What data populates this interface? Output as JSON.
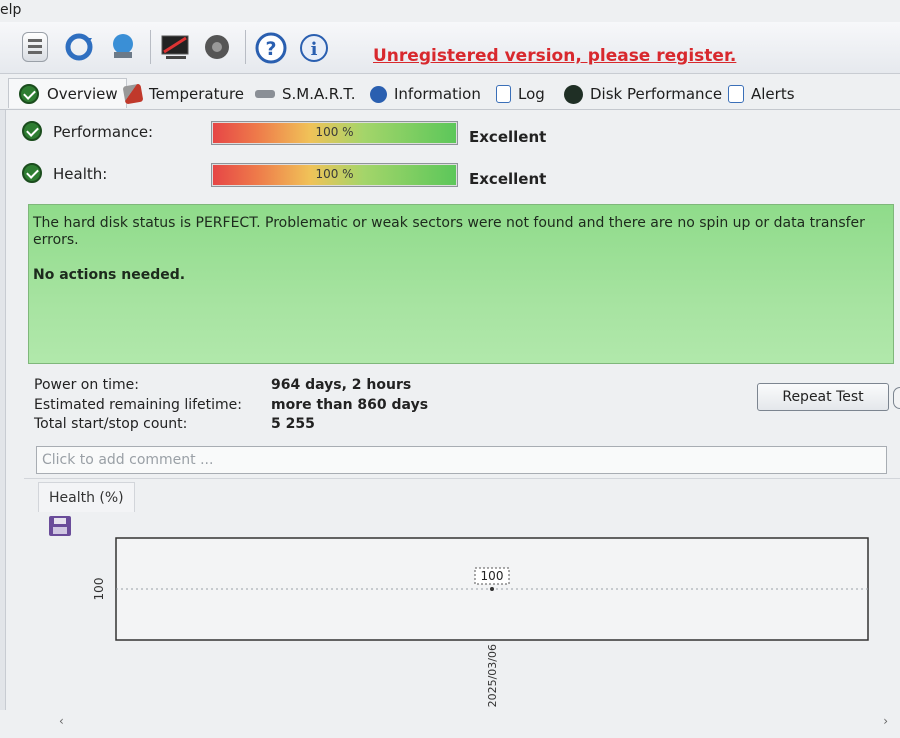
{
  "menu": {
    "help_partial": "elp"
  },
  "toolbar": {
    "icons": [
      "report-icon",
      "refresh-icon",
      "network-icon",
      "screenshot-icon",
      "speaker-icon",
      "help-icon",
      "info-icon"
    ],
    "unregistered_text": "Unregistered version, please register."
  },
  "tabs": [
    {
      "label": "Overview",
      "icon": "check-icon"
    },
    {
      "label": "Temperature",
      "icon": "thermometer-icon"
    },
    {
      "label": "S.M.A.R.T.",
      "icon": "smart-icon"
    },
    {
      "label": "Information",
      "icon": "info-icon"
    },
    {
      "label": "Log",
      "icon": "log-icon"
    },
    {
      "label": "Disk Performance",
      "icon": "disk-icon"
    },
    {
      "label": "Alerts",
      "icon": "alerts-icon"
    }
  ],
  "performance": {
    "label": "Performance:",
    "percent_text": "100 %",
    "level": 100,
    "rating": "Excellent"
  },
  "health": {
    "label": "Health:",
    "percent_text": "100 %",
    "level": 100,
    "rating": "Excellent"
  },
  "status": {
    "message": "The hard disk status is PERFECT. Problematic or weak sectors were not found and there are no spin up or data transfer errors.",
    "action": "No actions needed."
  },
  "stats": [
    {
      "label": "Power on time:",
      "value": "964 days, 2 hours"
    },
    {
      "label": "Estimated remaining lifetime:",
      "value": "more than 860 days"
    },
    {
      "label": "Total start/stop count:",
      "value": "5 255"
    }
  ],
  "buttons": {
    "repeat_test": "Repeat Test"
  },
  "comment": {
    "placeholder": "Click to add comment ...",
    "value": ""
  },
  "chart_tab": "Health (%)",
  "colors": {
    "accent_red": "#d8282d",
    "status_green": "#a6e3a0",
    "check_green": "#2e7d32"
  },
  "chart_data": {
    "type": "line",
    "x": [
      "2025/03/06"
    ],
    "series": [
      {
        "values": [
          100
        ]
      }
    ],
    "data_labels": [
      "100"
    ],
    "ytick_labels": [
      "100"
    ],
    "grid": true
  }
}
